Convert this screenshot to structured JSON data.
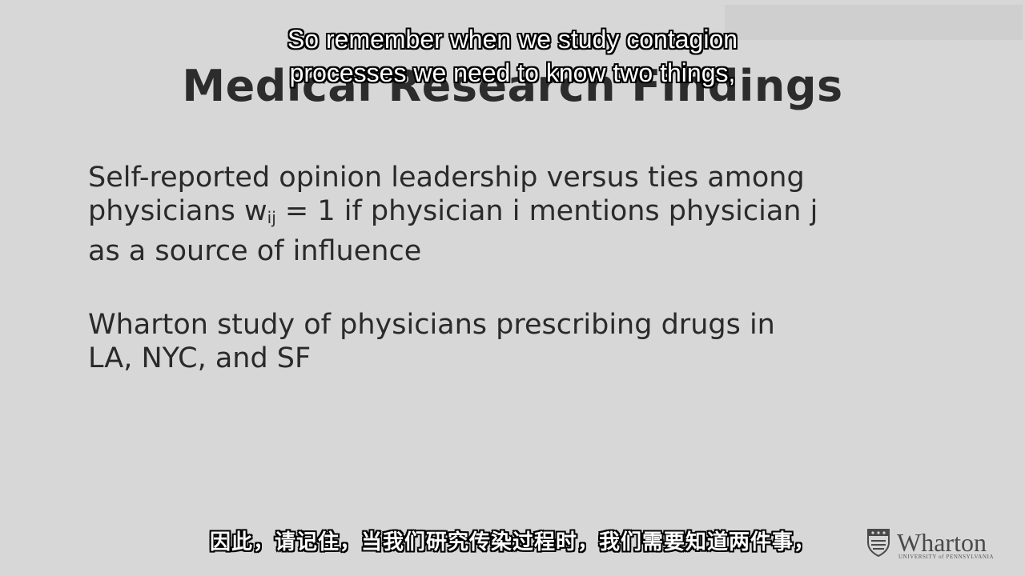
{
  "slide": {
    "title": "Medical Research Findings",
    "para1": {
      "line1": "Self-reported opinion leadership versus ties among",
      "line2_pre": "physicians w",
      "line2_sub": "ij",
      "line2_post": " = 1 if physician i mentions physician j",
      "line3": "as a source of influence"
    },
    "para2": {
      "line1": "Wharton study of physicians prescribing drugs in",
      "line2": "LA, NYC, and SF"
    }
  },
  "captions": {
    "english_line1": "So remember when we study contagion",
    "english_line2": "processes we need to know two things,",
    "chinese": "因此，请记住，当我们研究传染过程时，我们需要知道两件事，"
  },
  "logo": {
    "name": "Wharton",
    "subtitle": "UNIVERSITY of PENNSYLVANIA",
    "icon": "shield-icon"
  },
  "colors": {
    "background": "#d7d7d7",
    "text": "#2b2b2b",
    "caption_text": "#ffffff",
    "caption_outline": "#000000"
  }
}
